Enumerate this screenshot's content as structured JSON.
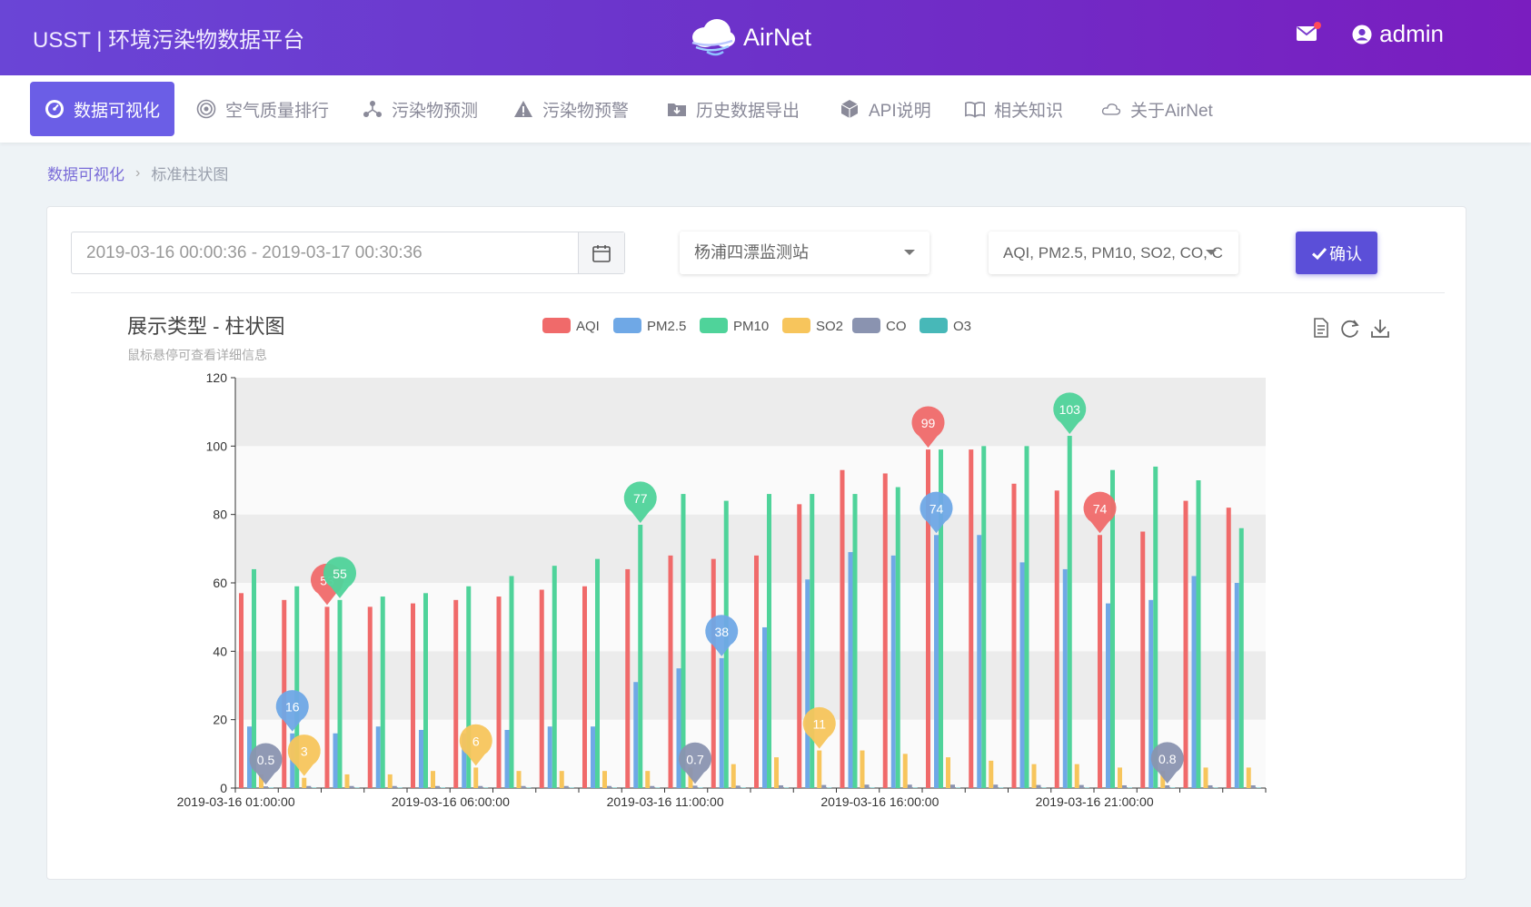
{
  "header": {
    "left_title": "USST | 环境污染物数据平台",
    "logo_text": "AirNet",
    "user_name": "admin"
  },
  "nav": {
    "items": [
      {
        "label": "数据可视化",
        "icon": "dashboard-icon",
        "active": true
      },
      {
        "label": "空气质量排行",
        "icon": "target-icon",
        "active": false
      },
      {
        "label": "污染物预测",
        "icon": "network-icon",
        "active": false
      },
      {
        "label": "污染物预警",
        "icon": "warning-icon",
        "active": false
      },
      {
        "label": "历史数据导出",
        "icon": "folder-download-icon",
        "active": false
      },
      {
        "label": "API说明",
        "icon": "cube-icon",
        "active": false
      },
      {
        "label": "相关知识",
        "icon": "book-icon",
        "active": false
      },
      {
        "label": "关于AirNet",
        "icon": "cloud-icon",
        "active": false
      }
    ]
  },
  "breadcrumb": {
    "root": "数据可视化",
    "current": "标准柱状图"
  },
  "filters": {
    "date_range": "2019-03-16 00:00:36 - 2019-03-17 00:30:36",
    "station": "杨浦四漂监测站",
    "pollutants": "AQI, PM2.5, PM10, SO2, CO, C",
    "confirm_label": "确认"
  },
  "colors": {
    "accent": "#5b4fd8",
    "AQI": "#f06a6a",
    "PM2.5": "#6fa8e6",
    "PM10": "#4fd39a",
    "SO2": "#f7c55c",
    "CO": "#8a93b0",
    "O3": "#47b8b8"
  },
  "chart_data": {
    "type": "bar",
    "title": "展示类型 - 柱状图",
    "subtitle": "鼠标悬停可查看详细信息",
    "ylim": [
      0,
      120
    ],
    "yticks": [
      0,
      20,
      40,
      60,
      80,
      100,
      120
    ],
    "legend": [
      "AQI",
      "PM2.5",
      "PM10",
      "SO2",
      "CO",
      "O3"
    ],
    "x_tick_labels": [
      {
        "index": 0,
        "label": "2019-03-16 01:00:00"
      },
      {
        "index": 5,
        "label": "2019-03-16 06:00:00"
      },
      {
        "index": 10,
        "label": "2019-03-16 11:00:00"
      },
      {
        "index": 15,
        "label": "2019-03-16 16:00:00"
      },
      {
        "index": 20,
        "label": "2019-03-16 21:00:00"
      }
    ],
    "categories": [
      "2019-03-16 01:00:00",
      "2019-03-16 02:00:00",
      "2019-03-16 03:00:00",
      "2019-03-16 04:00:00",
      "2019-03-16 05:00:00",
      "2019-03-16 06:00:00",
      "2019-03-16 07:00:00",
      "2019-03-16 08:00:00",
      "2019-03-16 09:00:00",
      "2019-03-16 10:00:00",
      "2019-03-16 11:00:00",
      "2019-03-16 12:00:00",
      "2019-03-16 13:00:00",
      "2019-03-16 14:00:00",
      "2019-03-16 15:00:00",
      "2019-03-16 16:00:00",
      "2019-03-16 17:00:00",
      "2019-03-16 18:00:00",
      "2019-03-16 19:00:00",
      "2019-03-16 20:00:00",
      "2019-03-16 21:00:00",
      "2019-03-16 22:00:00",
      "2019-03-16 23:00:00",
      "2019-03-17 00:00:00"
    ],
    "series": [
      {
        "name": "AQI",
        "values": [
          57,
          55,
          53,
          53,
          54,
          55,
          56,
          58,
          59,
          64,
          68,
          67,
          68,
          83,
          93,
          92,
          99,
          99,
          89,
          87,
          74,
          75,
          84,
          82
        ]
      },
      {
        "name": "PM2.5",
        "values": [
          18,
          16,
          16,
          18,
          17,
          16,
          17,
          18,
          18,
          31,
          35,
          38,
          47,
          61,
          69,
          68,
          74,
          74,
          66,
          64,
          54,
          55,
          62,
          60
        ]
      },
      {
        "name": "PM10",
        "values": [
          64,
          59,
          55,
          56,
          57,
          59,
          62,
          65,
          67,
          77,
          86,
          84,
          86,
          86,
          86,
          88,
          99,
          100,
          100,
          103,
          93,
          94,
          90,
          76
        ]
      },
      {
        "name": "SO2",
        "values": [
          4,
          3,
          4,
          4,
          5,
          6,
          5,
          5,
          5,
          5,
          6,
          7,
          9,
          11,
          11,
          10,
          9,
          8,
          7,
          7,
          6,
          5,
          6,
          6
        ]
      },
      {
        "name": "CO",
        "values": [
          0.5,
          0.6,
          0.6,
          0.6,
          0.6,
          0.6,
          0.6,
          0.6,
          0.6,
          0.6,
          0.7,
          0.7,
          0.8,
          0.9,
          1.0,
          1.0,
          1.0,
          1.0,
          0.9,
          0.9,
          0.8,
          0.8,
          0.8,
          0.8
        ]
      },
      {
        "name": "O3",
        "values": [
          0,
          0,
          0,
          0,
          0,
          0,
          0,
          0,
          0,
          0,
          0,
          0,
          0,
          0,
          0,
          0,
          0,
          0,
          0,
          0,
          0,
          0,
          0,
          0
        ]
      }
    ],
    "markers": [
      {
        "series": "AQI",
        "index": 2,
        "label": "53",
        "type": "min"
      },
      {
        "series": "AQI",
        "index": 16,
        "label": "99",
        "type": "max"
      },
      {
        "series": "AQI",
        "index": 20,
        "label": "74",
        "type": "max"
      },
      {
        "series": "PM2.5",
        "index": 1,
        "label": "16",
        "type": "min"
      },
      {
        "series": "PM2.5",
        "index": 11,
        "label": "38",
        "type": "min"
      },
      {
        "series": "PM2.5",
        "index": 16,
        "label": "74",
        "type": "max"
      },
      {
        "series": "PM10",
        "index": 2,
        "label": "55",
        "type": "min"
      },
      {
        "series": "PM10",
        "index": 9,
        "label": "77",
        "type": "min"
      },
      {
        "series": "PM10",
        "index": 19,
        "label": "103",
        "type": "max"
      },
      {
        "series": "SO2",
        "index": 1,
        "label": "3",
        "type": "min"
      },
      {
        "series": "SO2",
        "index": 5,
        "label": "6",
        "type": "min"
      },
      {
        "series": "SO2",
        "index": 13,
        "label": "11",
        "type": "max"
      },
      {
        "series": "CO",
        "index": 0,
        "label": "0.5",
        "type": "min"
      },
      {
        "series": "CO",
        "index": 10,
        "label": "0.7",
        "type": "min"
      },
      {
        "series": "CO",
        "index": 21,
        "label": "0.8",
        "type": "min"
      }
    ],
    "grid": "alternating-bands",
    "legend_position": "top-center",
    "toolbox": [
      "data-view-icon",
      "restore-icon",
      "save-image-icon"
    ]
  }
}
